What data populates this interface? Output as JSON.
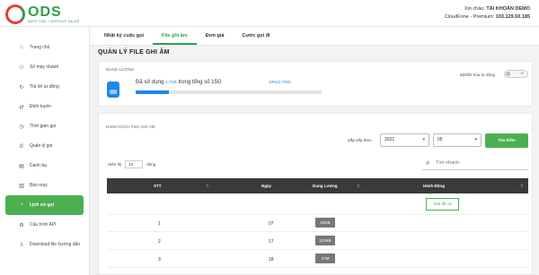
{
  "brand": {
    "logo_word": "ODS",
    "tagline": "SAVE TIME • IMPROVE VALUE"
  },
  "user": {
    "greeting": "Xin chào:",
    "name": "TÀI KHOẢN DEMO",
    "plan": "CloudFone - Premium:",
    "ip": "103.129.50.185"
  },
  "sidebar": {
    "items": [
      {
        "label": "Trang chủ",
        "icon": "home-icon",
        "glyph": "⌂"
      },
      {
        "label": "Số máy nhánh",
        "icon": "extensions-icon",
        "glyph": "⚇"
      },
      {
        "label": "Trả lời tự động",
        "icon": "auto-reply-icon",
        "glyph": "↻"
      },
      {
        "label": "Định tuyến",
        "icon": "routing-icon",
        "glyph": "⇄"
      },
      {
        "label": "Thời gian gọi",
        "icon": "clock-icon",
        "glyph": "◷"
      },
      {
        "label": "Quản lý gọi",
        "icon": "phone-icon",
        "glyph": "✆"
      },
      {
        "label": "Danh bạ",
        "icon": "contacts-icon",
        "glyph": "▤"
      },
      {
        "label": "Báo máy",
        "icon": "report-icon",
        "glyph": "▥"
      },
      {
        "label": "Lịch sử gọi",
        "icon": "history-icon",
        "glyph": "◔"
      },
      {
        "label": "Cấu hình API",
        "icon": "api-icon",
        "glyph": "⚙"
      },
      {
        "label": "Download file hướng dẫn",
        "icon": "download-icon",
        "glyph": "⇩"
      }
    ]
  },
  "tabs": [
    "Nhật ký cuộc gọi",
    "File ghi âm",
    "Đơn giá",
    "Cước gọi đi"
  ],
  "page_title": "QUẢN LÝ FILE GHI ÂM",
  "storage": {
    "title": "DUNG LƯỢNG",
    "used_prefix": "Đã sử dụng",
    "used_value": "2.7GB",
    "used_suffix": "trong tổng số 15G",
    "percent_label": "18%(2.7GB)",
    "percent": 18,
    "auto_delete_label": "Bật/tắt Xóa tự động",
    "toggle_text": "Tắt"
  },
  "list": {
    "title": "DANH SÁCH FILE GHI ÂM",
    "sort_label": "Sắp xếp theo",
    "year": "2021",
    "month": "05",
    "search_button": "Tìm kiếm",
    "show_prefix": "Hiển thị",
    "show_count": "10",
    "show_suffix": "dòng",
    "search_placeholder": "Tìm nhanh",
    "columns": {
      "stt": "STT",
      "day": "Ngày",
      "size": "Dung Lượng",
      "action": "Hành Động"
    },
    "clear_all": "Xóa tất cả",
    "rows": [
      {
        "stt": "1",
        "day": "07",
        "size": "63KB"
      },
      {
        "stt": "2",
        "day": "17",
        "size": "113KB"
      },
      {
        "stt": "3",
        "day": "18",
        "size": "27M"
      }
    ]
  }
}
